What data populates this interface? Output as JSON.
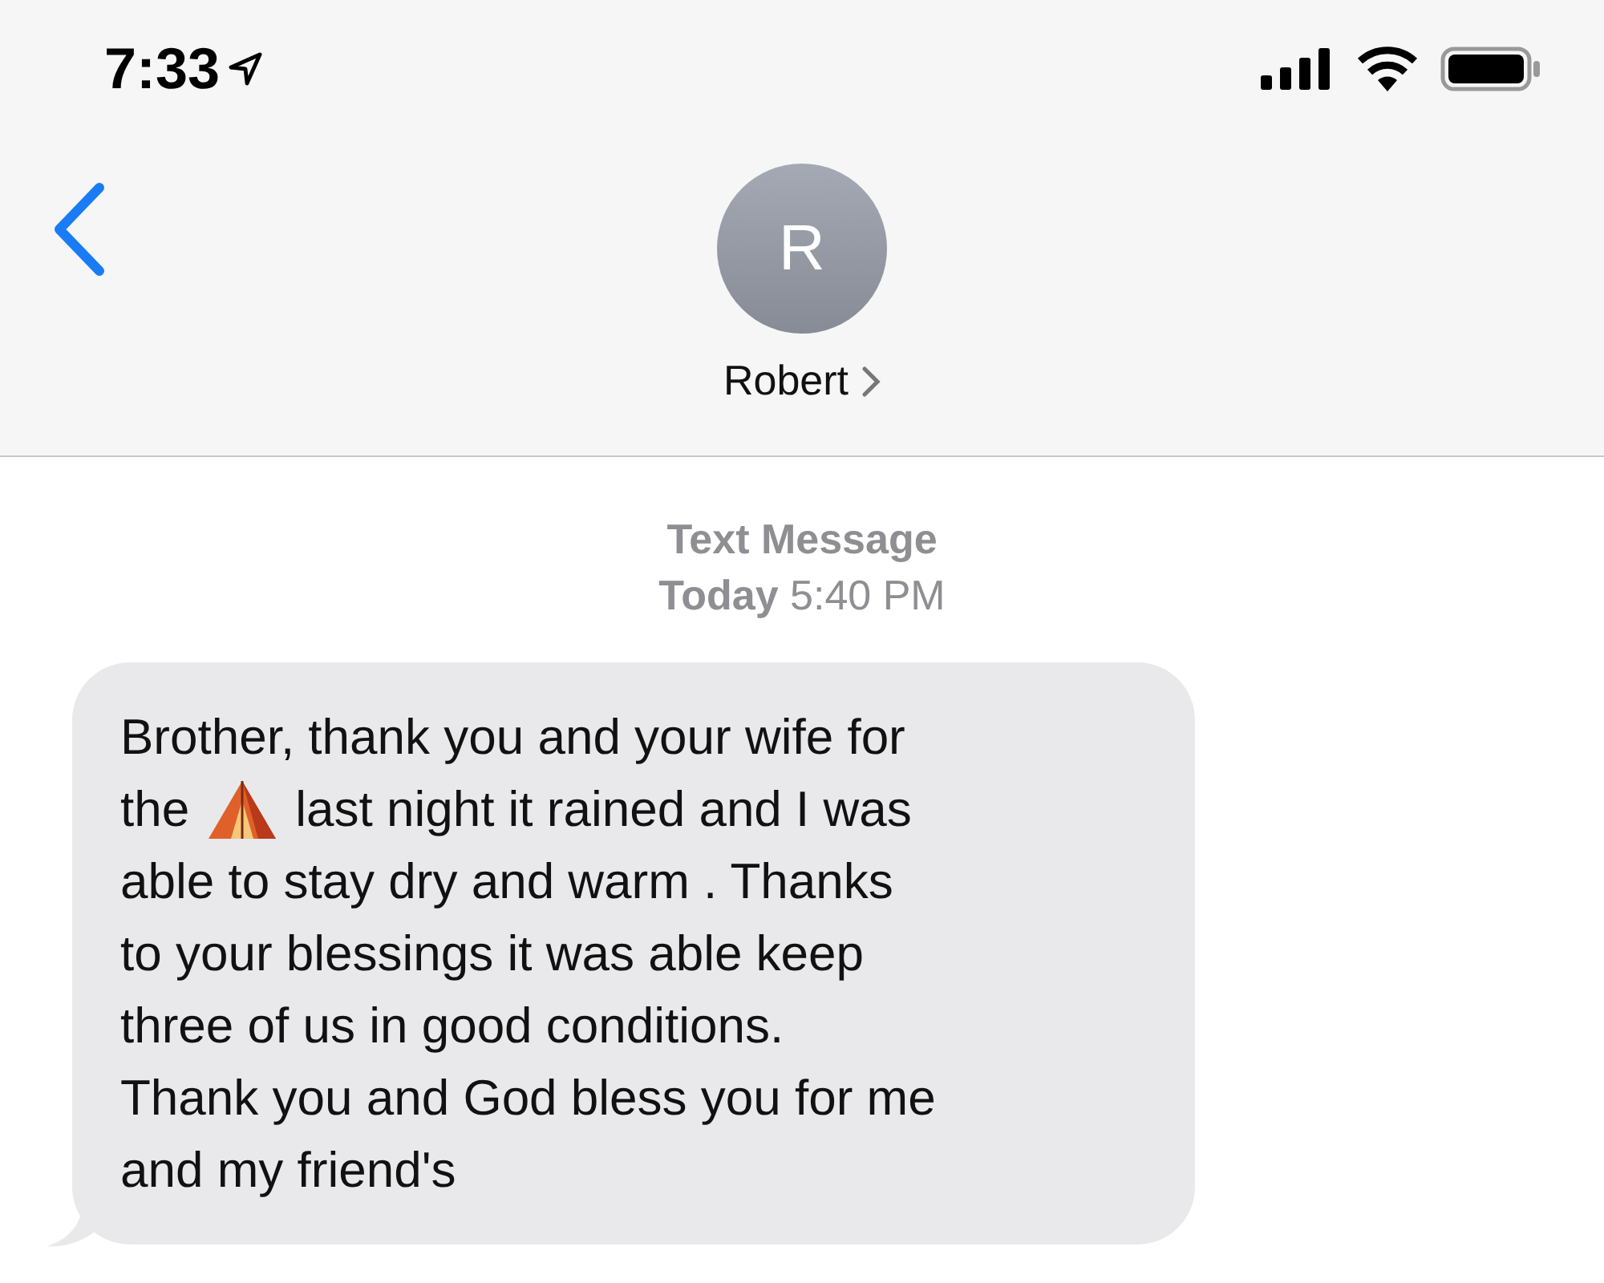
{
  "status_bar": {
    "time": "7:33"
  },
  "header": {
    "avatar_initial": "R",
    "contact_name": "Robert"
  },
  "thread": {
    "service": "Text Message",
    "timestamp": "**Today** 5:40 PM"
  },
  "message": {
    "lines": [
      {
        "kind": "text",
        "text": "Brother, thank you and your wife for"
      },
      {
        "kind": "emoji",
        "before": "the",
        "after": "last night it rained and I was"
      },
      {
        "kind": "text",
        "text": "able to stay dry and warm . Thanks"
      },
      {
        "kind": "text",
        "text": "to your blessings it was able keep"
      },
      {
        "kind": "text",
        "text": "three of us in good conditions."
      },
      {
        "kind": "text",
        "text": "Thank you and God bless you for me"
      },
      {
        "kind": "text",
        "text": "and my friend's"
      }
    ]
  }
}
